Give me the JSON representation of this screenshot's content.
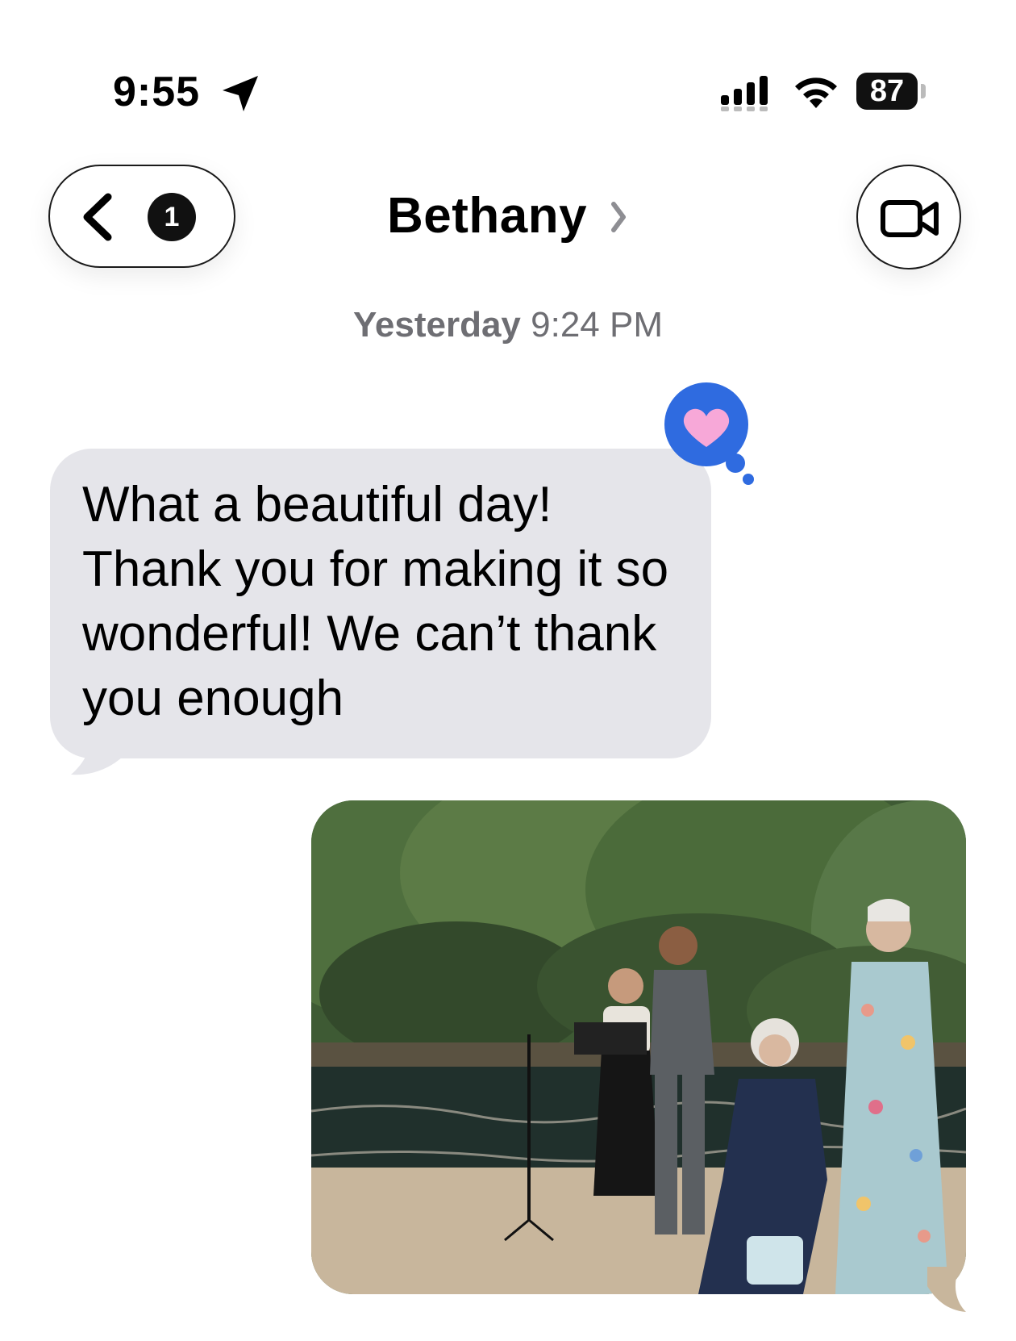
{
  "status_bar": {
    "time": "9:55",
    "battery": "87",
    "icons": [
      "location-arrow-icon",
      "cellular-signal-icon",
      "wifi-icon",
      "battery-icon"
    ]
  },
  "header": {
    "back_badge": "1",
    "contact_name": "Bethany",
    "icons": [
      "chevron-left-icon",
      "chevron-right-icon",
      "video-camera-icon"
    ]
  },
  "conversation": {
    "timestamp_day": "Yesterday",
    "timestamp_time": "9:24 PM",
    "messages": [
      {
        "direction": "incoming",
        "text": "What a beautiful day! Thank you for making it so wonderful! We can’t thank you enough",
        "tapback": "heart"
      },
      {
        "direction": "outgoing",
        "type": "photo"
      }
    ]
  },
  "colors": {
    "incoming_bubble": "#e5e5ea",
    "tapback_blue": "#2f6be0",
    "tapback_heart": "#f7a8d8",
    "timestamp_gray": "#6e6e73"
  }
}
